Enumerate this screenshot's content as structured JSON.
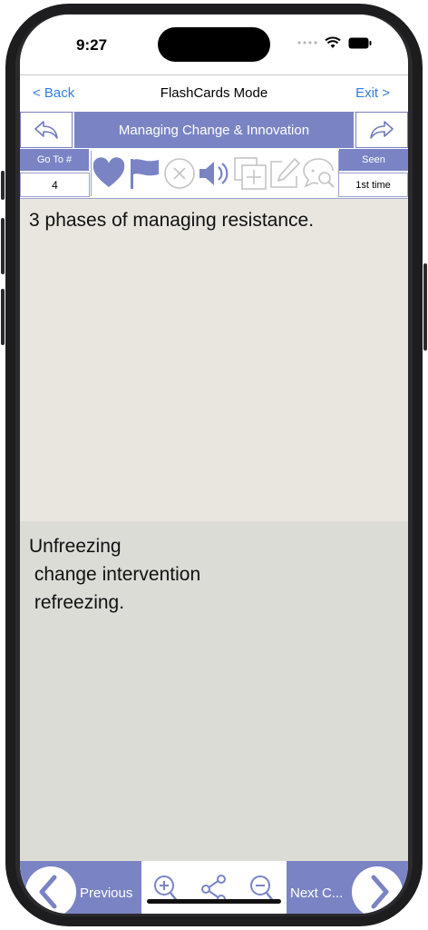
{
  "status": {
    "time": "9:27"
  },
  "nav": {
    "back_label": "< Back",
    "title": "FlashCards Mode",
    "exit_label": "Exit >"
  },
  "deck": {
    "title": "Managing Change & Innovation"
  },
  "toolbar": {
    "goto_label": "Go To #",
    "goto_value": "4",
    "seen_label": "Seen",
    "seen_value": "1st time",
    "icons": [
      "heart-icon",
      "flag-icon",
      "close-circle-icon",
      "speaker-icon",
      "copy-add-icon",
      "edit-icon",
      "chat-search-icon"
    ]
  },
  "card": {
    "question": "3 phases of managing resistance.",
    "answer": "Unfreezing\n change intervention\n refreezing."
  },
  "bottom": {
    "previous_label": "Previous",
    "next_label": "Next C...",
    "icons": [
      "zoom-in-icon",
      "share-icon",
      "zoom-out-icon"
    ]
  },
  "colors": {
    "accent": "#7a84c4",
    "link": "#2f7de1",
    "question_bg": "#e9e6df",
    "answer_bg": "#dcdcd7"
  }
}
